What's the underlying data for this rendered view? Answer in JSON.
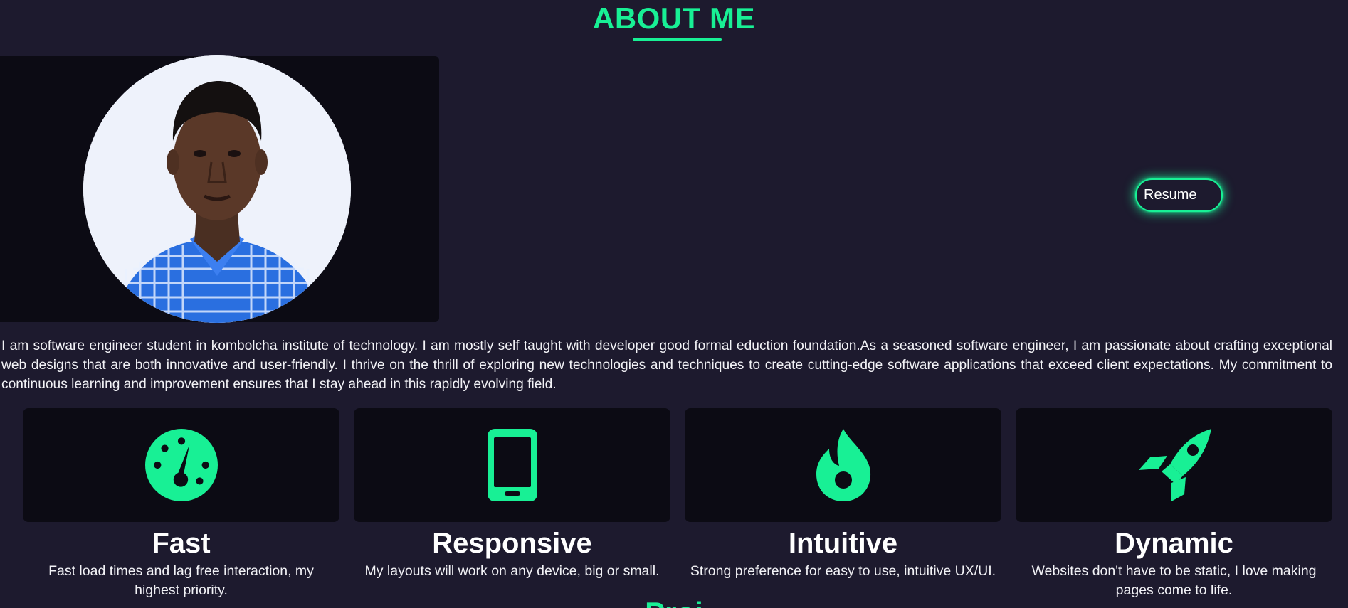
{
  "about": {
    "title": "ABOUT ME",
    "resume_label": "Resume",
    "bio": "I am software engineer student in kombolcha institute of technology. I am mostly self taught with developer good formal eduction foundation.As a seasoned software engineer, I am passionate about crafting exceptional web designs that are both innovative and user-friendly. I thrive on the thrill of exploring new technologies and techniques to create cutting-edge software applications that exceed client expectations. My commitment to continuous learning and improvement ensures that I stay ahead in this rapidly evolving field."
  },
  "features": [
    {
      "icon": "speedometer-icon",
      "title": "Fast",
      "description": "Fast load times and lag free interaction, my highest priority."
    },
    {
      "icon": "mobile-phone-icon",
      "title": "Responsive",
      "description": "My layouts will work on any device, big or small."
    },
    {
      "icon": "flame-icon",
      "title": "Intuitive",
      "description": "Strong preference for easy to use, intuitive UX/UI."
    },
    {
      "icon": "rocket-icon",
      "title": "Dynamic",
      "description": "Websites don't have to be static, I love making pages come to life."
    }
  ],
  "next_section": {
    "title_partial": "Proj"
  },
  "colors": {
    "accent": "#18f095",
    "background": "#1d1a2e",
    "panel": "#0c0b14"
  }
}
